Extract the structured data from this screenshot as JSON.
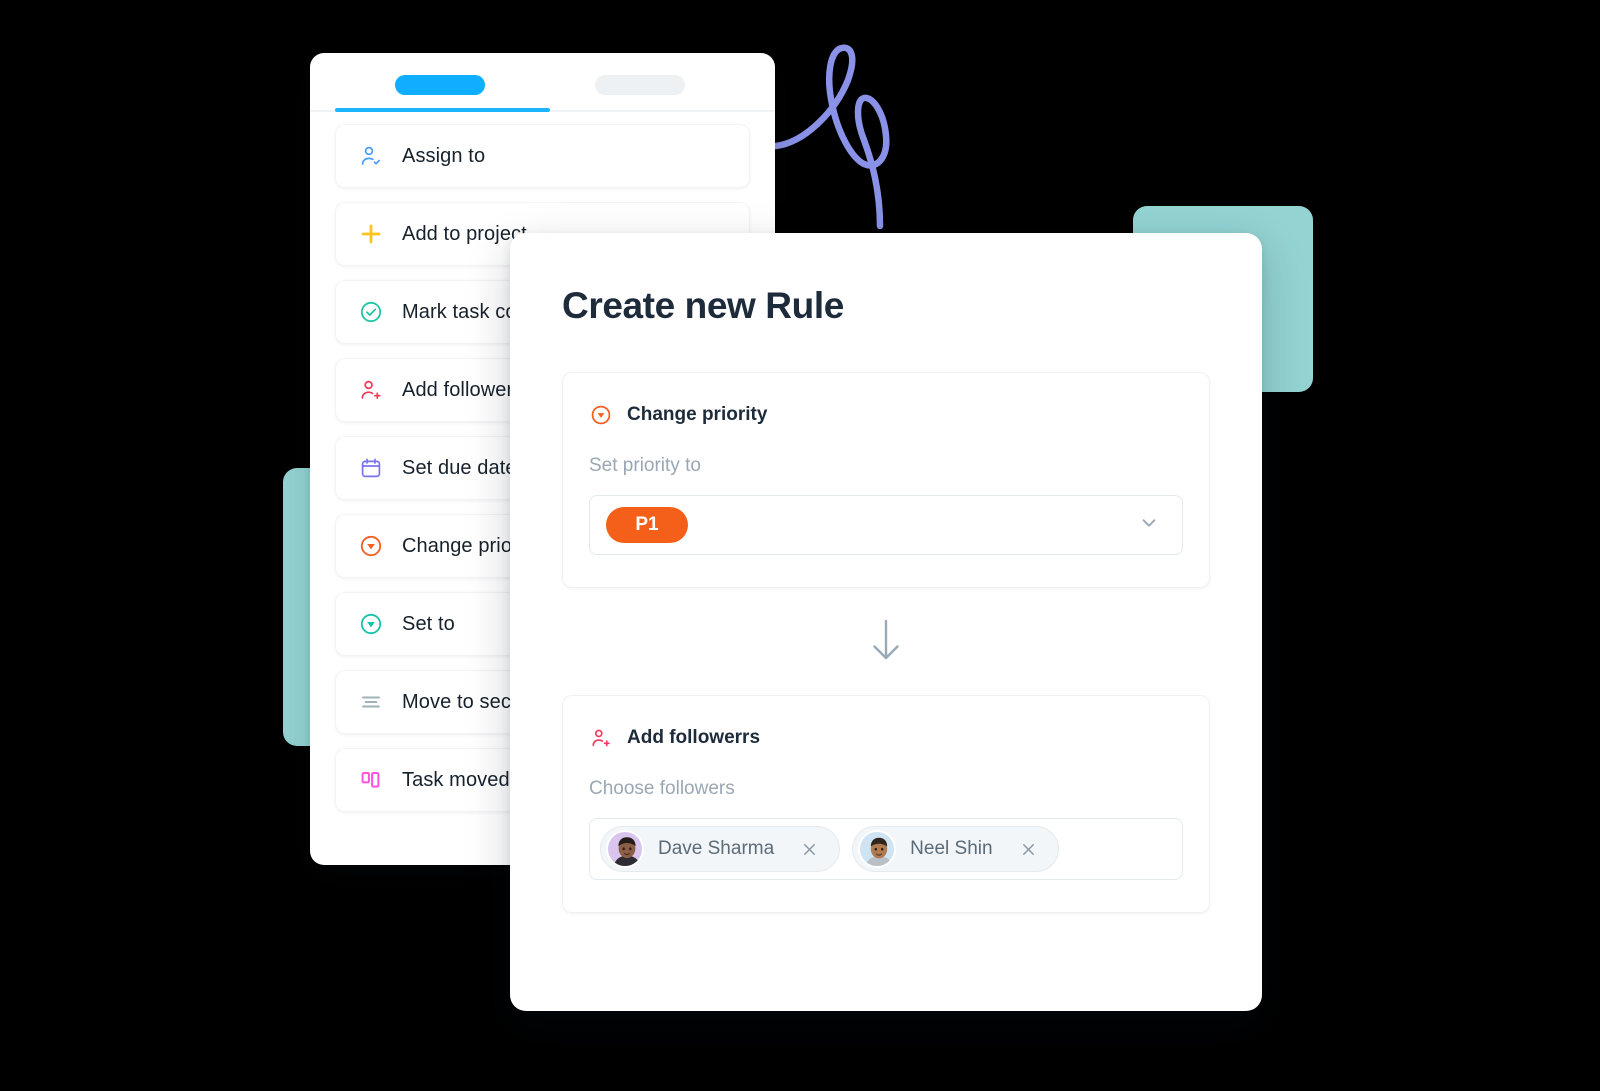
{
  "decor": {
    "teal_color": "#93d3d2",
    "squiggle_color": "#8a92e8"
  },
  "left_panel": {
    "tabs": [
      {
        "name": "tab-active",
        "state": "active",
        "color": "#0faeff"
      },
      {
        "name": "tab-inactive",
        "state": "inactive",
        "color": "#edf1f3"
      }
    ],
    "actions": [
      {
        "icon": "assign-user-icon",
        "label": "Assign to",
        "color": "#4a9cf6"
      },
      {
        "icon": "plus-icon",
        "label": "Add to project",
        "color": "#ffc31f"
      },
      {
        "icon": "check-circle-icon",
        "label": "Mark task complete",
        "color": "#1ec8a5"
      },
      {
        "icon": "add-follower-icon",
        "label": "Add followers",
        "color": "#f6375b"
      },
      {
        "icon": "calendar-icon",
        "label": "Set due date",
        "color": "#7b72f0"
      },
      {
        "icon": "priority-down-icon",
        "label": "Change priority",
        "color": "#fb5c1f"
      },
      {
        "icon": "status-down-icon",
        "label": "Set to",
        "color": "#14c4ab"
      },
      {
        "icon": "move-section-icon",
        "label": "Move to section",
        "color": "#9fb3b8"
      },
      {
        "icon": "board-icon",
        "label": "Task moved to",
        "color": "#fb52e0"
      }
    ]
  },
  "modal": {
    "title": "Create new Rule",
    "flow_arrow_icon": "arrow-down-icon",
    "blocks": [
      {
        "icon": "priority-down-icon",
        "icon_color": "#fb5c1f",
        "heading": "Change priority",
        "field_label": "Set priority to",
        "control": "select",
        "selected_value": "P1",
        "selected_color": "#f4601a",
        "chevron_icon": "chevron-down-icon"
      },
      {
        "icon": "add-follower-icon",
        "icon_color": "#f6375b",
        "heading": "Add followerrs",
        "field_label": "Choose followers",
        "control": "token-input",
        "tokens": [
          {
            "name": "Dave Sharma",
            "avatar_bg": "#d9c4ee",
            "remove_icon": "close-icon"
          },
          {
            "name": "Neel Shin",
            "avatar_bg": "#cfe4f2",
            "remove_icon": "close-icon"
          }
        ]
      }
    ]
  }
}
